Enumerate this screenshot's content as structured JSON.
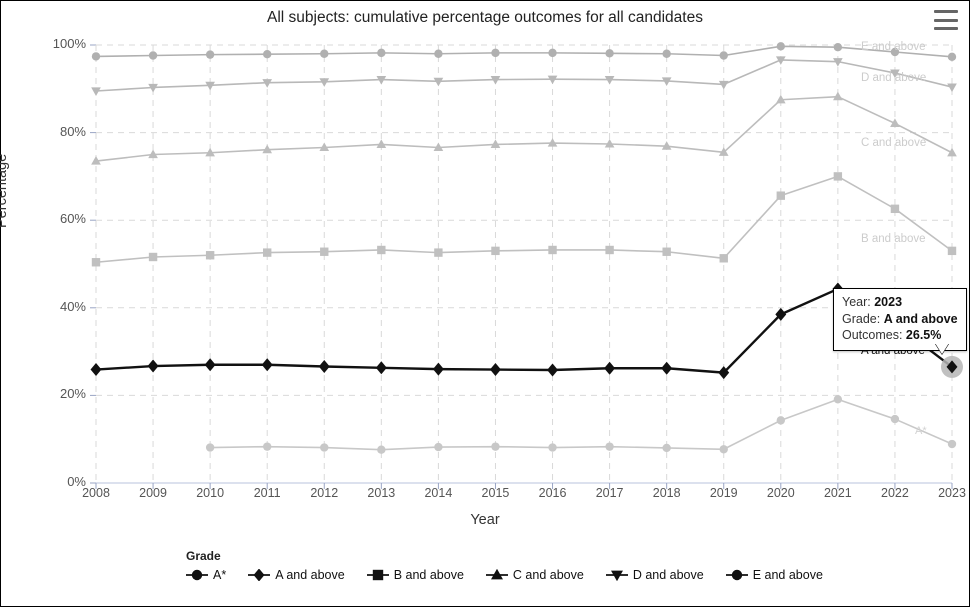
{
  "window": {
    "menu_icon": "hamburger-menu-icon"
  },
  "chart_data": {
    "type": "line",
    "title": "All subjects: cumulative percentage outcomes for all candidates",
    "xlabel": "Year",
    "ylabel": "Percentage",
    "grid": true,
    "legend_position": "bottom",
    "legend_title": "Grade",
    "ylim": [
      0,
      100
    ],
    "yticks": [
      "0%",
      "20%",
      "40%",
      "60%",
      "80%",
      "100%"
    ],
    "ytick_values": [
      0,
      20,
      40,
      60,
      80,
      100
    ],
    "categories": [
      2008,
      2009,
      2010,
      2011,
      2012,
      2013,
      2014,
      2015,
      2016,
      2017,
      2018,
      2019,
      2020,
      2021,
      2022,
      2023
    ],
    "series": [
      {
        "name": "A*",
        "marker": "circle",
        "color": "#c8c8c8",
        "inline_label": "A*",
        "values": [
          null,
          null,
          8.1,
          8.3,
          8.1,
          7.6,
          8.2,
          8.3,
          8.1,
          8.3,
          8.0,
          7.7,
          14.3,
          19.1,
          14.6,
          8.9
        ]
      },
      {
        "name": "A and above",
        "marker": "diamond",
        "color": "#111111",
        "highlighted": true,
        "inline_label": "A and above",
        "values": [
          25.9,
          26.7,
          27.0,
          27.0,
          26.6,
          26.3,
          26.0,
          25.9,
          25.8,
          26.2,
          26.2,
          25.2,
          38.5,
          44.3,
          36.4,
          26.5
        ]
      },
      {
        "name": "B and above",
        "marker": "square",
        "color": "#c0c0c0",
        "inline_label": "B and above",
        "values": [
          50.4,
          51.6,
          52.0,
          52.6,
          52.8,
          53.2,
          52.6,
          53.0,
          53.2,
          53.2,
          52.8,
          51.3,
          65.6,
          70.0,
          62.6,
          53.0
        ]
      },
      {
        "name": "C and above",
        "marker": "triangle-up",
        "color": "#bdbdbd",
        "inline_label": "C and above",
        "values": [
          73.5,
          75.0,
          75.4,
          76.1,
          76.6,
          77.3,
          76.6,
          77.3,
          77.6,
          77.4,
          76.9,
          75.5,
          87.5,
          88.2,
          82.1,
          75.4
        ]
      },
      {
        "name": "D and above",
        "marker": "triangle-down",
        "color": "#b8b8b8",
        "inline_label": "D and above",
        "values": [
          89.5,
          90.3,
          90.8,
          91.4,
          91.6,
          92.1,
          91.7,
          92.1,
          92.2,
          92.1,
          91.8,
          91.0,
          96.6,
          96.2,
          93.6,
          90.4
        ]
      },
      {
        "name": "E and above",
        "marker": "circle",
        "color": "#b0b0b0",
        "inline_label": "E and above",
        "values": [
          97.4,
          97.6,
          97.8,
          97.9,
          98.0,
          98.2,
          98.0,
          98.2,
          98.2,
          98.1,
          98.0,
          97.6,
          99.7,
          99.5,
          98.4,
          97.3
        ]
      }
    ]
  },
  "tooltip": {
    "year_label": "Year:",
    "year_value": "2023",
    "grade_label": "Grade:",
    "grade_value": "A and above",
    "outcomes_label": "Outcomes:",
    "outcomes_value": "26.5%"
  }
}
